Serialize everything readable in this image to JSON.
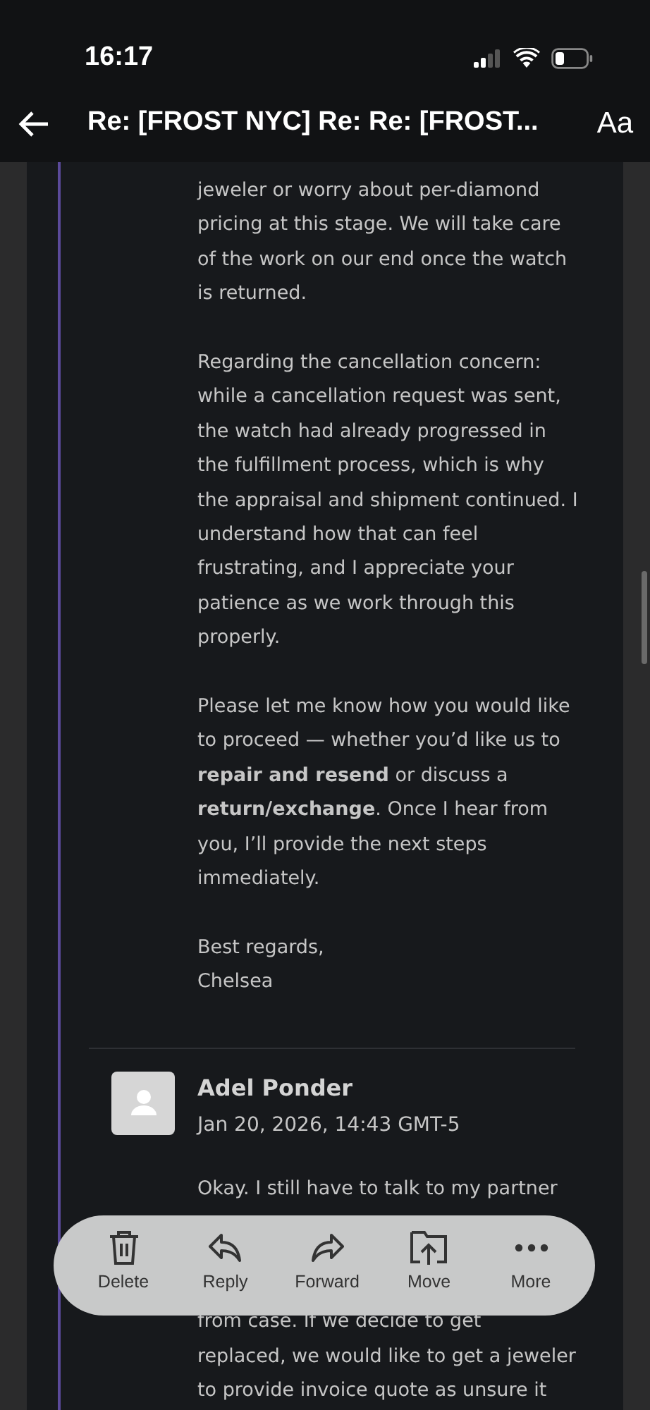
{
  "status_bar": {
    "time": "16:17"
  },
  "header": {
    "title": "Re: [FROST NYC] Re: Re: [FROST...",
    "text_size_button": "Aa"
  },
  "messages": [
    {
      "paragraphs": [
        [
          "jeweler or worry about per-diamond",
          "pricing at this stage. We will take care",
          "of the work on our end once the watch",
          "is returned."
        ],
        [
          "Regarding the cancellation concern:",
          "while a cancellation request was sent,",
          "the watch had already progressed in",
          "the fulfillment process, which is why",
          "the appraisal and shipment continued. I",
          "understand how that can feel",
          "frustrating, and I appreciate your",
          "patience as we work through this",
          "properly."
        ],
        [
          "Please let me know how you would like",
          "to proceed — whether you’d like us to",
          "**repair and resend** or discuss a",
          "**return/exchange**. Once I hear from",
          "you, I’ll provide the next steps",
          "immediately."
        ],
        [
          "Best regards,",
          "Chelsea"
        ]
      ]
    },
    {
      "sender": "Adel Ponder",
      "date": "Jan 20, 2026, 14:43 GMT-5",
      "lines_before": [
        "Okay. I still have to talk to my partner"
      ],
      "lines_after": [
        "from case. If we decide to get",
        "replaced, we would like to get a jeweler",
        "to provide invoice quote as unsure it"
      ]
    }
  ],
  "toolbar": [
    {
      "kind": "delete",
      "label": "Delete"
    },
    {
      "kind": "reply",
      "label": "Reply"
    },
    {
      "kind": "forward",
      "label": "Forward"
    },
    {
      "kind": "move",
      "label": "Move"
    },
    {
      "kind": "more",
      "label": "More"
    }
  ]
}
